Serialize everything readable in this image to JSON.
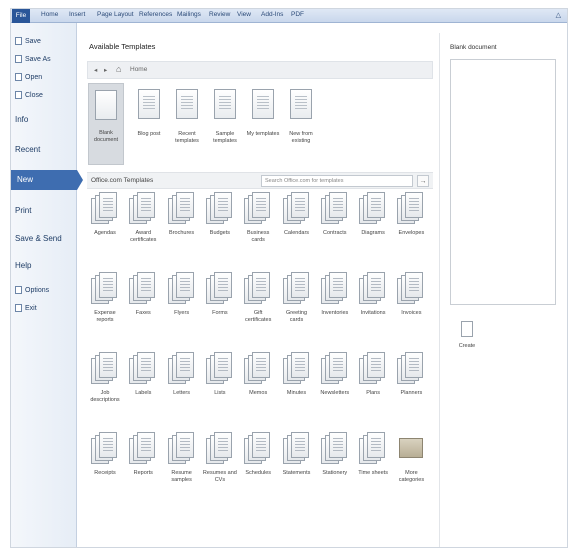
{
  "ribbon": {
    "tabs": [
      "File",
      "Home",
      "Insert",
      "Page Layout",
      "References",
      "Mailings",
      "Review",
      "View",
      "Add-Ins",
      "PDF"
    ],
    "window_controls": "△"
  },
  "left_nav": {
    "save": "Save",
    "save_as": "Save As",
    "open": "Open",
    "close": "Close",
    "info": "Info",
    "recent": "Recent",
    "new": "New",
    "print": "Print",
    "save_send": "Save & Send",
    "help": "Help",
    "options": "Options",
    "exit": "Exit"
  },
  "main": {
    "title": "Available Templates",
    "nav_back": "◂",
    "nav_forward": "▸",
    "home_icon": "⌂",
    "home_label": "Home",
    "top_templates": [
      {
        "label": "Blank\ndocument"
      },
      {
        "label": "Blog post"
      },
      {
        "label": "Recent\ntemplates"
      },
      {
        "label": "Sample\ntemplates"
      },
      {
        "label": "My templates"
      },
      {
        "label": "New from\nexisting"
      }
    ],
    "office_title": "Office.com Templates",
    "search_placeholder": "Search Office.com for templates",
    "search_go": "→",
    "categories": [
      "Agendas",
      "Award\ncertificates",
      "Brochures",
      "Budgets",
      "Business\ncards",
      "Calendars",
      "Contracts",
      "Diagrams",
      "Envelopes",
      "Expense\nreports",
      "Faxes",
      "Flyers",
      "Forms",
      "Gift\ncertificates",
      "Greeting\ncards",
      "Inventories",
      "Invitations",
      "Invoices",
      "Job\ndescriptions",
      "Labels",
      "Letters",
      "Lists",
      "Memos",
      "Minutes",
      "Newsletters",
      "Plans",
      "Planners",
      "Receipts",
      "Reports",
      "Resume\nsamples",
      "Resumes and\nCVs",
      "Schedules",
      "Statements",
      "Stationery",
      "Time sheets",
      "More\ncategories"
    ]
  },
  "right_panel": {
    "title": "Blank document",
    "create_label": "Create"
  }
}
